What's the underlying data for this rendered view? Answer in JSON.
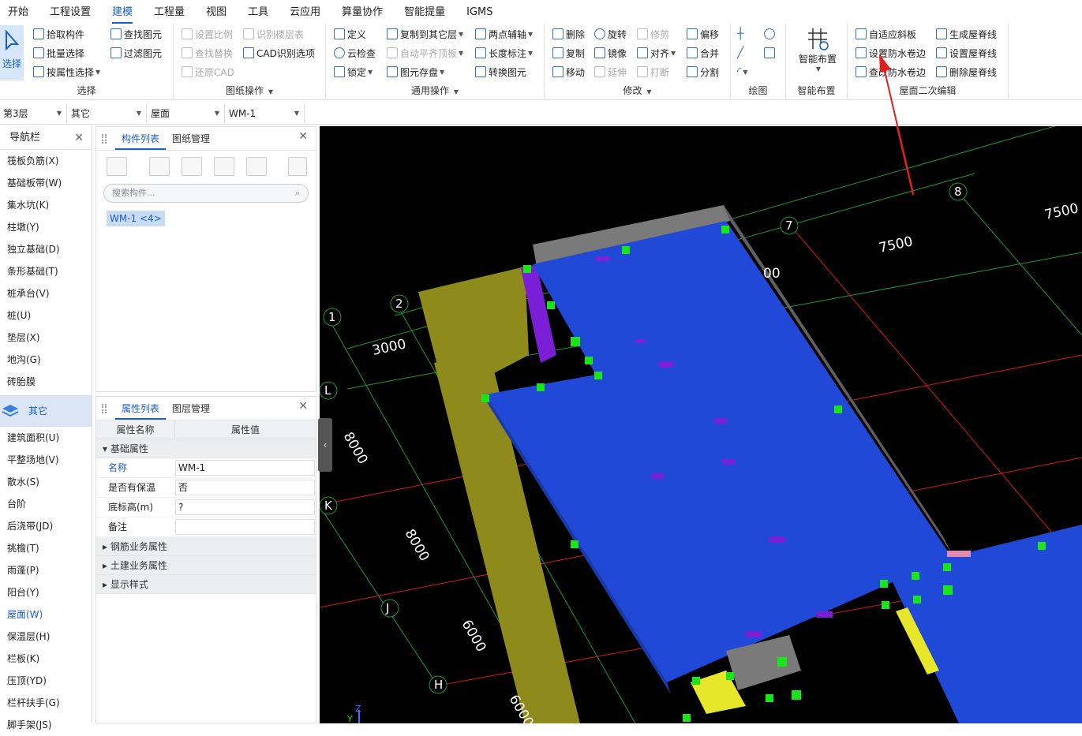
{
  "menu": {
    "tabs": [
      "开始",
      "工程设置",
      "建模",
      "工程量",
      "视图",
      "工具",
      "云应用",
      "算量协作",
      "智能提量",
      "IGMS"
    ],
    "active": "建模"
  },
  "ribbon": {
    "select_group": {
      "big": "选择",
      "items": [
        "拾取构件",
        "批量选择",
        "按属性选择"
      ],
      "items2": [
        "查找图元",
        "过滤图元"
      ],
      "title": "选择"
    },
    "drawing_ops": {
      "items": [
        "设置比例",
        "查找替换",
        "还原CAD"
      ],
      "items2": [
        "识别楼层表",
        "CAD识别选项"
      ],
      "title": "图纸操作"
    },
    "general_ops": {
      "col1": [
        "定义",
        "云检查",
        "锁定"
      ],
      "col2": [
        "复制到其它层",
        "自动平齐顶板",
        "图元存盘"
      ],
      "col3": [
        "两点辅轴",
        "长度标注",
        "转换图元"
      ],
      "title": "通用操作"
    },
    "modify": {
      "col1": [
        "删除",
        "复制",
        "移动"
      ],
      "col2": [
        "旋转",
        "镜像",
        "延伸"
      ],
      "col3": [
        "修剪",
        "对齐",
        "打断"
      ],
      "col4": [
        "偏移",
        "合并",
        "分割"
      ],
      "title": "修改"
    },
    "draw": {
      "title": "绘图"
    },
    "smart": {
      "big": "智能布置",
      "title": "智能布置"
    },
    "roof_edit": {
      "col1": [
        "自适应斜板",
        "设置防水卷边",
        "查改防水卷边"
      ],
      "col2": [
        "生成屋脊线",
        "设置屋脊线",
        "删除屋脊线"
      ],
      "title": "屋面二次编辑"
    }
  },
  "toolbar2": {
    "floor": "第3层",
    "category": "其它",
    "type": "屋面",
    "component": "WM-1"
  },
  "nav": {
    "title": "导航栏",
    "items_top": [
      "筏板负筋(X)",
      "基础板带(W)",
      "集水坑(K)",
      "柱墩(Y)",
      "独立基础(D)",
      "条形基础(T)",
      "桩承台(V)",
      "桩(U)",
      "垫层(X)",
      "地沟(G)",
      "砖胎膜"
    ],
    "group": "其它",
    "items_bottom": [
      "建筑面积(U)",
      "平整场地(V)",
      "散水(S)",
      "台阶",
      "后浇带(JD)",
      "挑檐(T)",
      "雨蓬(P)",
      "阳台(Y)",
      "屋面(W)",
      "保温层(H)",
      "栏板(K)",
      "压顶(YD)",
      "栏杆扶手(G)",
      "脚手架(JS)"
    ],
    "selected": "屋面(W)"
  },
  "comp_panel": {
    "tab_active": "构件列表",
    "tab2": "图纸管理",
    "search_placeholder": "搜索构件...",
    "item": "WM-1 <4>"
  },
  "prop_panel": {
    "tab_active": "属性列表",
    "tab2": "图层管理",
    "col_name": "属性名称",
    "col_value": "属性值",
    "section_basic": "基础属性",
    "rows": [
      {
        "name": "名称",
        "value": "WM-1"
      },
      {
        "name": "是否有保温",
        "value": "否"
      },
      {
        "name": "底标高(m)",
        "value": "?"
      },
      {
        "name": "备注",
        "value": ""
      }
    ],
    "sections": [
      "钢筋业务属性",
      "土建业务属性",
      "显示样式"
    ]
  },
  "viewport": {
    "axis_labels": [
      "1",
      "2",
      "7",
      "8",
      "L",
      "K",
      "J",
      "H"
    ],
    "dims": [
      "3000",
      "7500",
      "7500",
      "8000",
      "8000",
      "6000",
      "6000",
      "00"
    ],
    "axes_z": "Z",
    "axes_y": "Y",
    "colors": {
      "roof": "#1f49d6",
      "wall": "#8f8a1c",
      "marker": "#19e619",
      "parapet": "#7a7a7a",
      "grid_red": "#d41818",
      "grid_green": "#1f9a2c"
    }
  }
}
